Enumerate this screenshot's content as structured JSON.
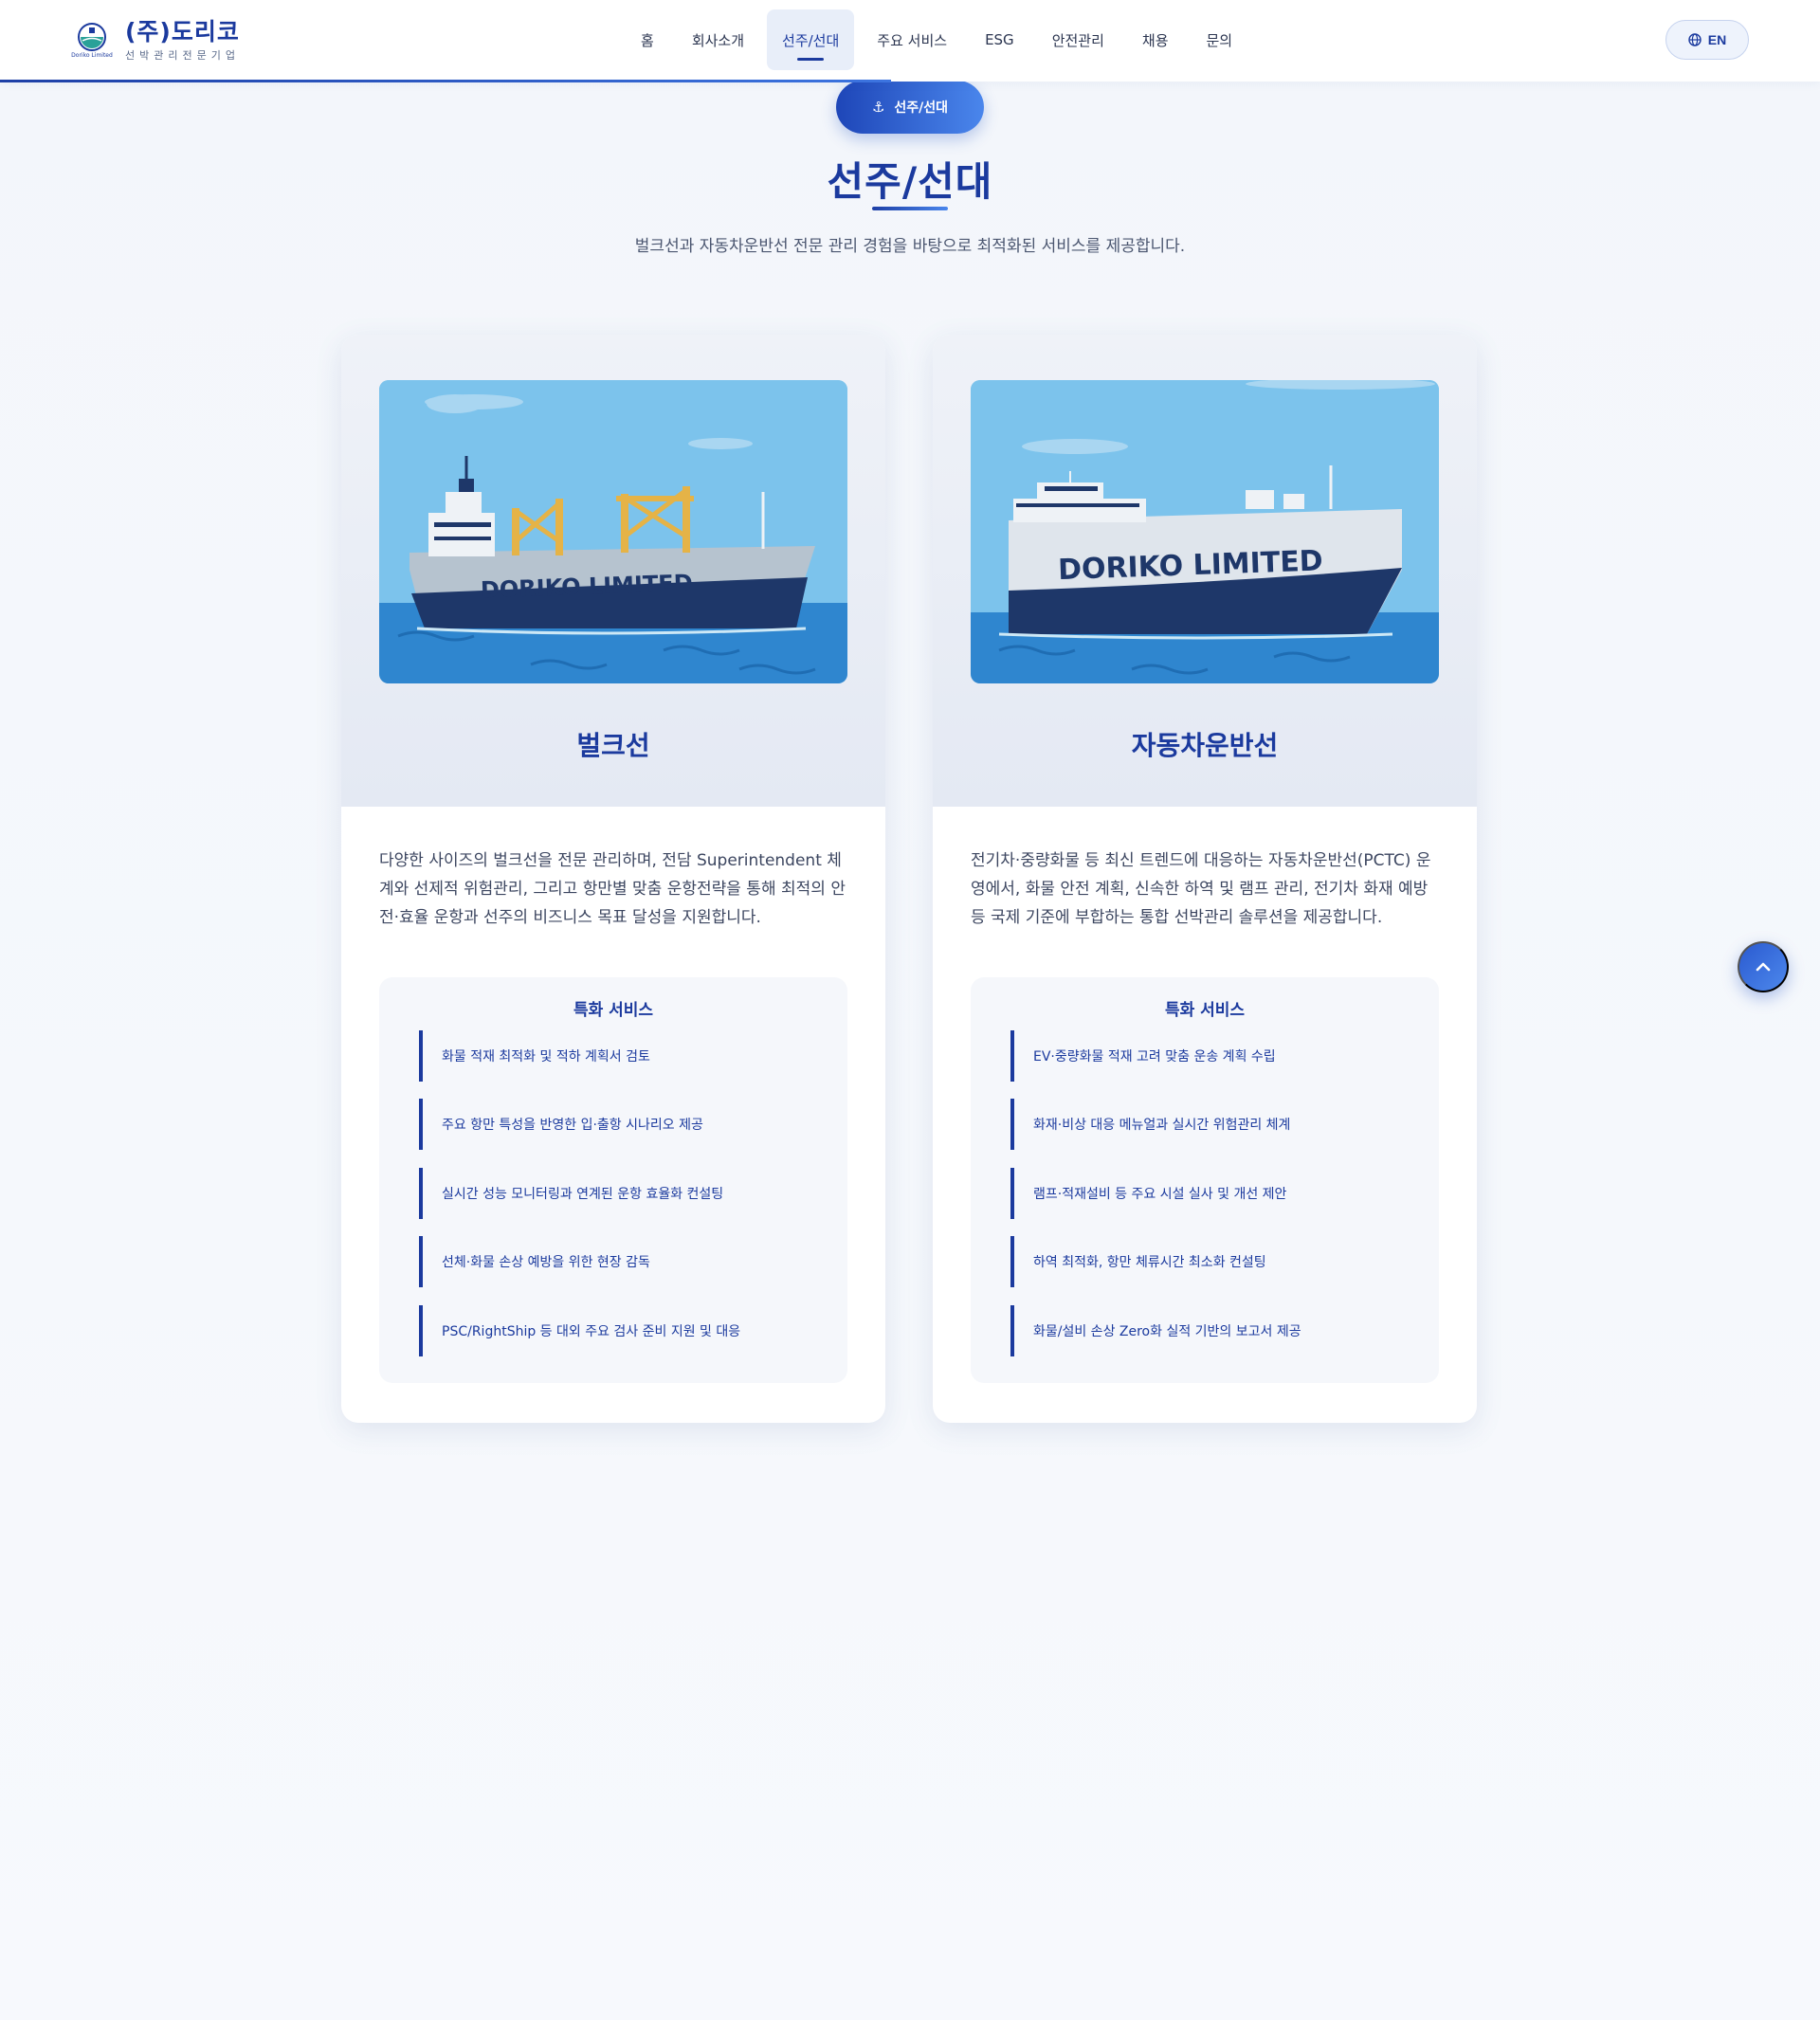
{
  "header": {
    "logo": {
      "title": "(주)도리코",
      "subtitle": "선박관리전문기업",
      "mark_text": "Doriko Limited"
    },
    "nav": [
      {
        "label": "홈",
        "active": false
      },
      {
        "label": "회사소개",
        "active": false
      },
      {
        "label": "선주/선대",
        "active": true
      },
      {
        "label": "주요 서비스",
        "active": false
      },
      {
        "label": "ESG",
        "active": false
      },
      {
        "label": "안전관리",
        "active": false
      },
      {
        "label": "채용",
        "active": false
      },
      {
        "label": "문의",
        "active": false
      }
    ],
    "lang_button": "EN",
    "lang_icon": "globe-icon"
  },
  "section": {
    "badge_label": "선주/선대",
    "badge_icon": "anchor-icon",
    "title": "선주/선대",
    "subtitle": "벌크선과 자동차운반선 전문 관리 경험을 바탕으로 최적화된 서비스를 제공합니다."
  },
  "cards": [
    {
      "image_ship_text": "DORIKO LIMITED",
      "title": "벌크선",
      "description": "다양한 사이즈의 벌크선을 전문 관리하며, 전담 Superintendent 체계와 선제적 위험관리, 그리고 항만별 맞춤 운항전략을 통해 최적의 안전·효율 운항과 선주의 비즈니스 목표 달성을 지원합니다.",
      "special_title": "특화 서비스",
      "special_items": [
        "화물 적재 최적화 및 적하 계획서 검토",
        "주요 항만 특성을 반영한 입·출항 시나리오 제공",
        "실시간 성능 모니터링과 연계된 운항 효율화 컨설팅",
        "선체·화물 손상 예방을 위한 현장 감독",
        "PSC/RightShip 등 대외 주요 검사 준비 지원 및 대응"
      ]
    },
    {
      "image_ship_text": "DORIKO LIMITED",
      "title": "자동차운반선",
      "description": "전기차·중량화물 등 최신 트렌드에 대응하는 자동차운반선(PCTC) 운영에서, 화물 안전 계획, 신속한 하역 및 램프 관리, 전기차 화재 예방 등 국제 기준에 부합하는 통합 선박관리 솔루션을 제공합니다.",
      "special_title": "특화 서비스",
      "special_items": [
        "EV·중량화물 적재 고려 맞춤 운송 계획 수립",
        "화재·비상 대응 메뉴얼과 실시간 위험관리 체계",
        "램프·적재설비 등 주요 시설 실사 및 개선 제안",
        "하역 최적화, 항만 체류시간 최소화 컨설팅",
        "화물/설비 손상 Zero화 실적 기반의 보고서 제공"
      ]
    }
  ],
  "back_to_top_icon": "chevron-up-icon",
  "colors": {
    "primary": "#1b3a9e",
    "accent": "#3c74e0",
    "background": "#f3f6fb",
    "sky": "#7cc3ec",
    "sea": "#2f86cf"
  }
}
